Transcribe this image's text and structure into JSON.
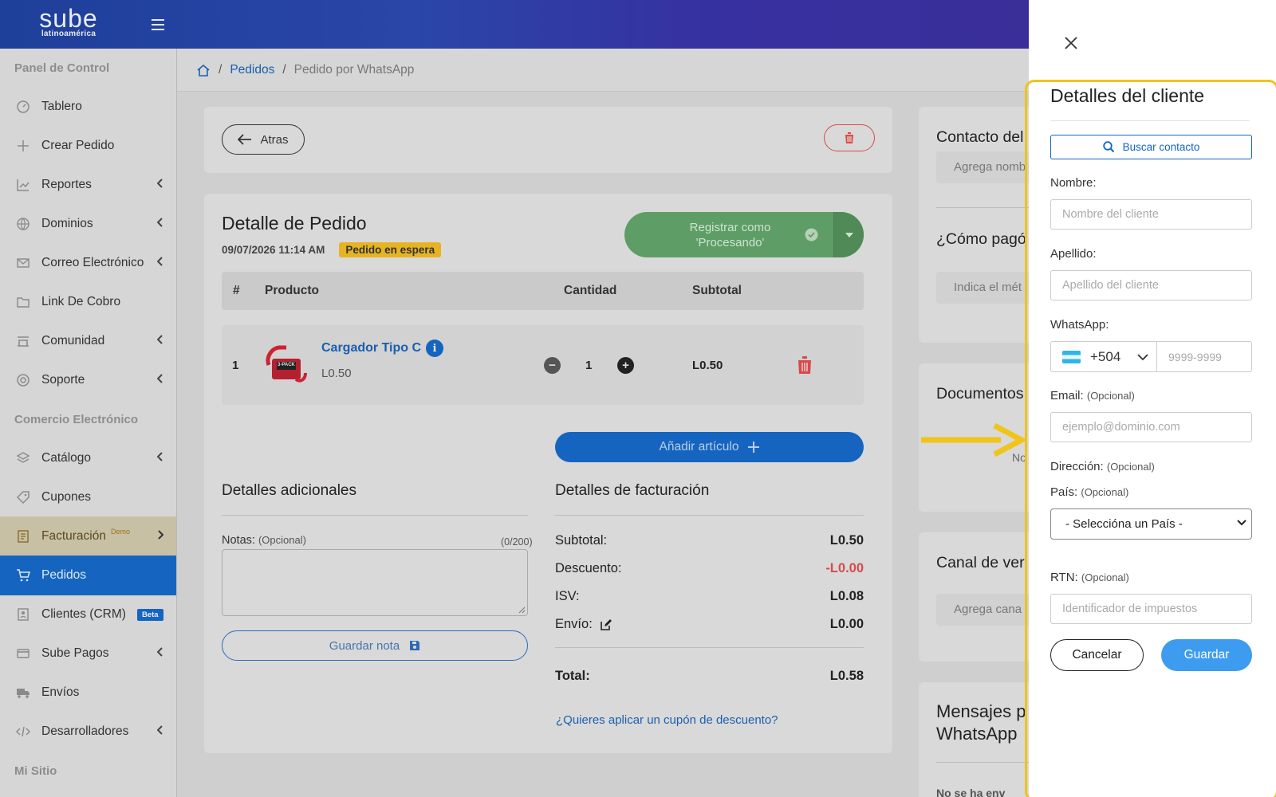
{
  "brand": {
    "name": "sube",
    "subtitle": "latinoamérica"
  },
  "sidebar": {
    "sections": [
      "Panel de Control",
      "Comercio Electrónico",
      "Mi Sitio"
    ],
    "items": [
      {
        "label": "Tablero",
        "icon": "dashboard-icon"
      },
      {
        "label": "Crear Pedido",
        "icon": "plus-icon"
      },
      {
        "label": "Reportes",
        "icon": "chart-icon",
        "expandable": true
      },
      {
        "label": "Dominios",
        "icon": "globe-icon",
        "expandable": true
      },
      {
        "label": "Correo Electrónico",
        "icon": "mail-icon",
        "expandable": true
      },
      {
        "label": "Link De Cobro",
        "icon": "folder-icon"
      },
      {
        "label": "Comunidad",
        "icon": "community-icon",
        "expandable": true
      },
      {
        "label": "Soporte",
        "icon": "support-icon",
        "expandable": true
      },
      {
        "label": "Catálogo",
        "icon": "layers-icon",
        "expandable": true
      },
      {
        "label": "Cupones",
        "icon": "tag-icon"
      },
      {
        "label": "Facturación",
        "icon": "invoice-icon",
        "badge": "Demo",
        "expandable": true
      },
      {
        "label": "Pedidos",
        "icon": "cart-icon",
        "active": true
      },
      {
        "label": "Clientes (CRM)",
        "icon": "contacts-icon",
        "badge": "Beta"
      },
      {
        "label": "Sube Pagos",
        "icon": "card-icon",
        "expandable": true
      },
      {
        "label": "Envíos",
        "icon": "truck-icon"
      },
      {
        "label": "Desarrolladores",
        "icon": "code-icon",
        "expandable": true
      }
    ]
  },
  "breadcrumb": {
    "items": [
      "Pedidos",
      "Pedido por WhatsApp"
    ]
  },
  "topcard": {
    "back_label": "Atras"
  },
  "order": {
    "title": "Detalle de Pedido",
    "datetime": "09/07/2026 11:14 AM",
    "status": "Pedido en espera",
    "register_label_1": "Registrar como",
    "register_label_2": "'Procesando'",
    "columns": [
      "#",
      "Producto",
      "Cantidad",
      "Subtotal"
    ],
    "items": [
      {
        "index": "1",
        "name": "Cargador Tipo C",
        "price": "L0.50",
        "qty": "1",
        "subtotal": "L0.50",
        "image_label": "3-PACK"
      }
    ],
    "add_item_label": "Añadir artículo"
  },
  "additional": {
    "title": "Detalles adicionales",
    "notes_label": "Notas:",
    "notes_optional": "(Opcional)",
    "notes_count": "(0/200)",
    "save_note_label": "Guardar nota"
  },
  "billing": {
    "title": "Detalles de facturación",
    "rows": [
      {
        "label": "Subtotal:",
        "value": "L0.50"
      },
      {
        "label": "Descuento:",
        "value": "-L0.00"
      },
      {
        "label": "ISV:",
        "value": "L0.08"
      },
      {
        "label": "Envío:",
        "value": "L0.00"
      }
    ],
    "total_label": "Total:",
    "total_value": "L0.58",
    "coupon_link": "¿Quieres aplicar un cupón de descuento?"
  },
  "right_cards": {
    "contact_title": "Contacto del",
    "contact_field": "Agrega nomb",
    "payment_title": "¿Cómo pagó",
    "payment_field": "Indica el mét",
    "documents_title": "Documentos",
    "documents_note": "No",
    "channel_title": "Canal de ver",
    "channel_field": "Agrega cana",
    "messages_title_1": "Mensajes p",
    "messages_title_2": "WhatsApp",
    "messages_note": "No se ha env"
  },
  "client_panel": {
    "title": "Detalles del cliente",
    "search_label": "Buscar contacto",
    "name_label": "Nombre:",
    "name_placeholder": "Nombre del cliente",
    "lastname_label": "Apellido:",
    "lastname_placeholder": "Apellido del cliente",
    "whatsapp_label": "WhatsApp:",
    "country_code": "+504",
    "phone_placeholder": "9999-9999",
    "email_label": "Email:",
    "email_placeholder": "ejemplo@dominio.com",
    "address_label": "Dirección:",
    "country_label": "País:",
    "country_value": "- Seleccióna un País -",
    "rtn_label": "RTN:",
    "rtn_placeholder": "Identificador de impuestos",
    "optional": "(Opcional)",
    "cancel_label": "Cancelar",
    "save_label": "Guardar"
  },
  "colors": {
    "primary": "#1565c0",
    "success": "#5e9d66",
    "danger": "#d84a4a",
    "warning": "#e6b423",
    "highlight": "#f0c419"
  }
}
